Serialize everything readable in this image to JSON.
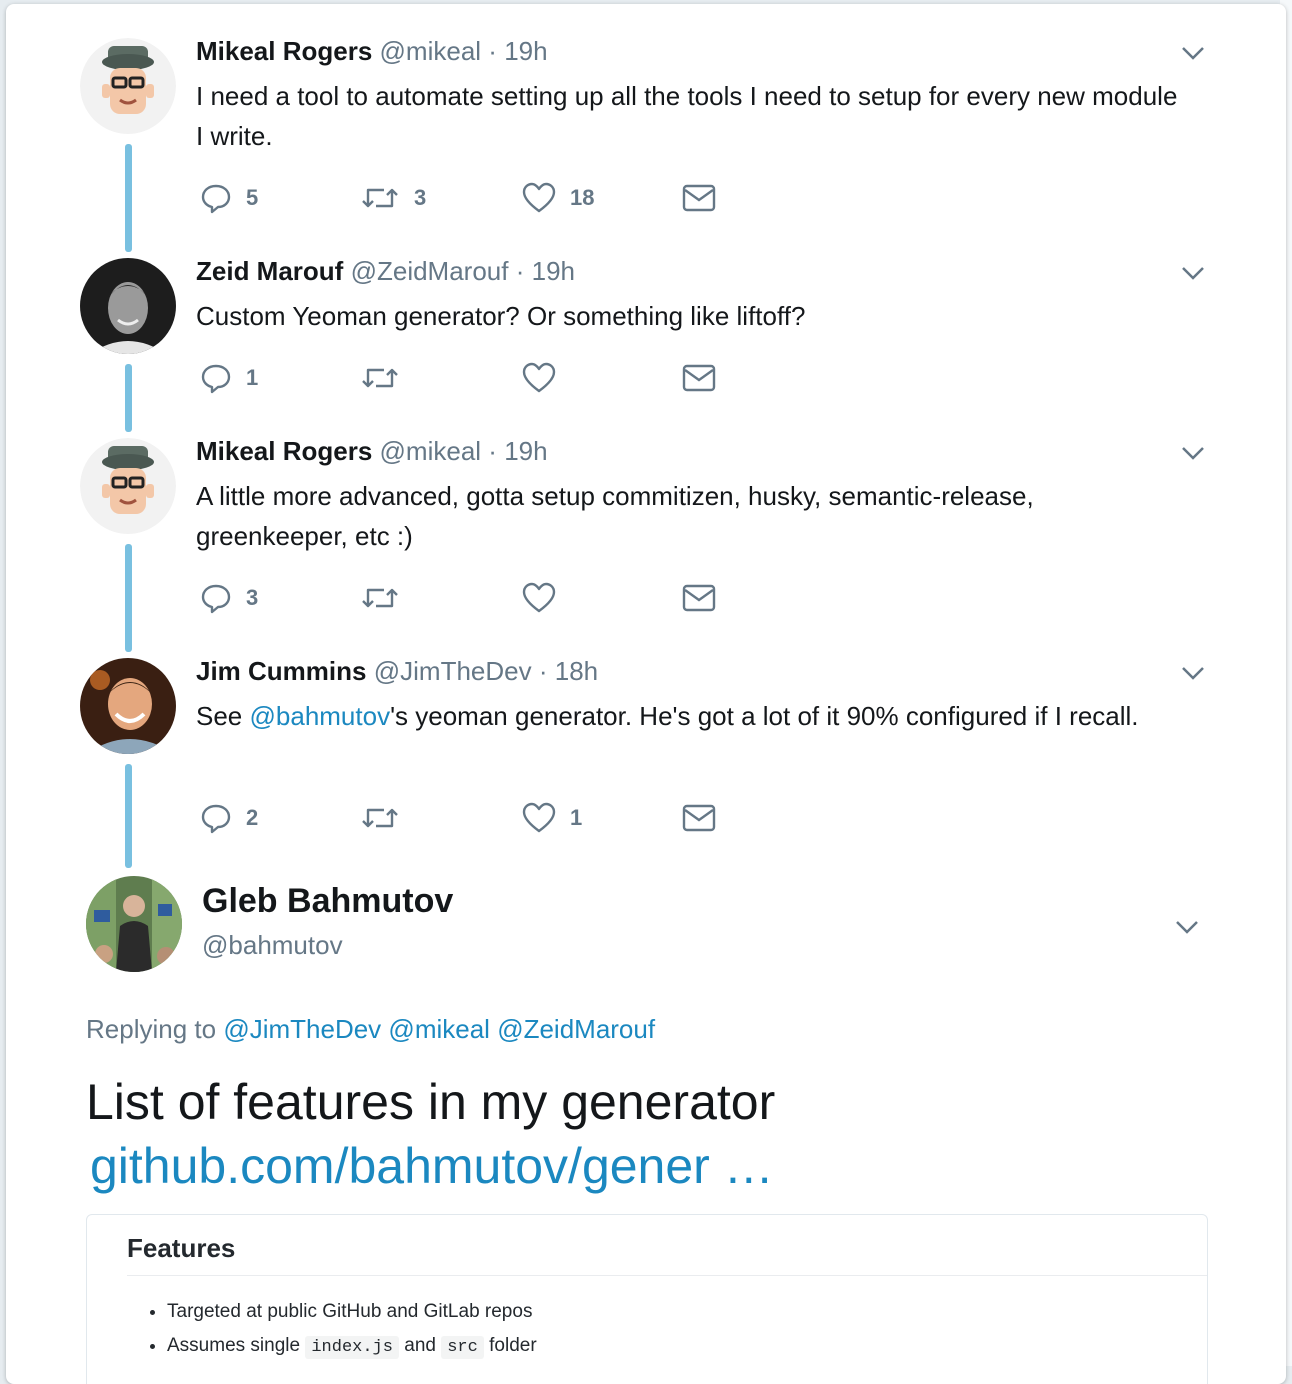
{
  "tweets": [
    {
      "name": "Mikeal Rogers",
      "handle": "@mikeal",
      "time": "19h",
      "text": "I need a tool to automate setting up all the tools I need to setup for every new module I write.",
      "replies": "5",
      "retweets": "3",
      "likes": "18"
    },
    {
      "name": "Zeid Marouf",
      "handle": "@ZeidMarouf",
      "time": "19h",
      "text": "Custom Yeoman generator? Or something like liftoff?",
      "replies": "1",
      "retweets": "",
      "likes": ""
    },
    {
      "name": "Mikeal Rogers",
      "handle": "@mikeal",
      "time": "19h",
      "text": "A little more advanced, gotta setup commitizen, husky, semantic-release, greenkeeper, etc :)",
      "replies": "3",
      "retweets": "",
      "likes": ""
    },
    {
      "name": "Jim Cummins",
      "handle": "@JimTheDev",
      "time": "18h",
      "text_pre": "See ",
      "mention": "@bahmutov",
      "text_post": "'s yeoman generator. He's got a lot of it 90% configured if I recall.",
      "replies": "2",
      "retweets": "",
      "likes": "1"
    }
  ],
  "main_tweet": {
    "name": "Gleb Bahmutov",
    "handle": "@bahmutov",
    "replying_label": "Replying to",
    "replying_mentions": [
      "@JimTheDev",
      "@mikeal",
      "@ZeidMarouf"
    ],
    "text": "List of features in my generator",
    "link": "github.com/bahmutov/gener …"
  },
  "preview": {
    "title": "Features",
    "items": [
      {
        "text": "Targeted at public GitHub and GitLab repos"
      },
      {
        "pre": "Assumes single ",
        "code1": "index.js",
        "mid": " and ",
        "code2": "src",
        "post": " folder"
      }
    ]
  },
  "colors": {
    "thread_line": "#79c0e0",
    "link": "#1b88c0",
    "muted": "#657786"
  },
  "icons": [
    "reply-icon",
    "retweet-icon",
    "like-icon",
    "message-icon",
    "chevron-down-icon"
  ]
}
